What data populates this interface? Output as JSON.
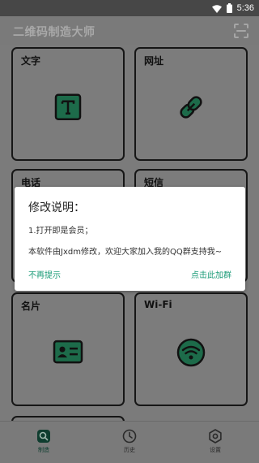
{
  "status_bar": {
    "time": "5:36",
    "wifi_icon": "wifi-icon",
    "battery_icon": "battery-icon"
  },
  "app_bar": {
    "title": "二维码制造大师",
    "scan_icon": "scan-icon"
  },
  "cards": [
    {
      "label": "文字",
      "icon": "text-icon"
    },
    {
      "label": "网址",
      "icon": "link-icon"
    },
    {
      "label": "电话",
      "icon": "phone-icon"
    },
    {
      "label": "短信",
      "icon": "sms-icon"
    },
    {
      "label": "名片",
      "icon": "contact-card-icon"
    },
    {
      "label": "Wi-Fi",
      "icon": "wifi-icon"
    }
  ],
  "dialog": {
    "title": "修改说明：",
    "line1": "1.打开即是会员；",
    "line2": "本软件由Jxdm修改，欢迎大家加入我的QQ群支持我~",
    "dismiss_label": "不再提示",
    "join_label": "点击此加群"
  },
  "bottom_nav": [
    {
      "label": "制造",
      "icon": "qr-search-icon",
      "active": true
    },
    {
      "label": "历史",
      "icon": "clock-icon",
      "active": false
    },
    {
      "label": "设置",
      "icon": "settings-icon",
      "active": false
    }
  ],
  "colors": {
    "accent": "#1a9b77",
    "icon_green": "#1d6b4a",
    "card_border": "#161616"
  }
}
